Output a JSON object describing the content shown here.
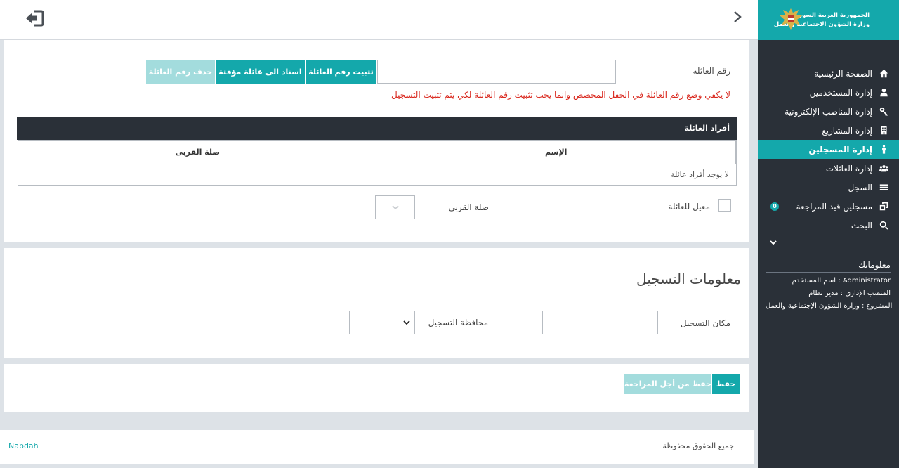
{
  "header": {
    "brand_line1": "الجمهورية العربية السورية",
    "brand_line2": "وزارة الشؤون الاجتماعية والعمل"
  },
  "sidebar": {
    "items": [
      {
        "label": "الصفحة الرئيسية",
        "icon": "home-icon"
      },
      {
        "label": "إدارة المستخدمين",
        "icon": "user-icon"
      },
      {
        "label": "إدارة المناصب الإلكترونية",
        "icon": "key-icon"
      },
      {
        "label": "إدارة المشاريع",
        "icon": "building-icon"
      },
      {
        "label": "إدارة المسجلين",
        "icon": "person-icon",
        "active": true
      },
      {
        "label": "إدارة العائلات",
        "icon": "users-icon"
      },
      {
        "label": "السجل",
        "icon": "list-icon"
      },
      {
        "label": "مسجلين قيد المراجعة",
        "icon": "review-icon",
        "badge": "0"
      },
      {
        "label": "البحث",
        "icon": "search-icon"
      }
    ],
    "info_title": "معلوماتك",
    "info_username": "اسم المستخدم : Administrator",
    "info_position": "المنصب الإداري : مدير نظام",
    "info_project": "المشروع : وزارة الشؤون الإجتماعية والعمل"
  },
  "family": {
    "number_label": "رقم العائلة",
    "number_value": "",
    "btn_confirm": "تثبيت رقم العائلة",
    "btn_assign_temp": "اسناد الى عائلة مؤقتة",
    "btn_delete": "حذف رقم العائلة",
    "warning": "لا يكفي وضع رقم العائلة في الحقل المخصص وانما يجب تثبيت رقم العائلة لكي يتم تثبيت التسجيل",
    "members_title": "أفراد العائلة",
    "col_name": "الإسم",
    "col_relation": "صلة القربى",
    "empty": "لا يوجد أفراد عائلة",
    "provider_label": "معيل للعائلة",
    "relation_label": "صلة القربى",
    "relation_value": ""
  },
  "registration": {
    "title": "معلومات التسجيل",
    "place_label": "مكان التسجيل",
    "place_value": "",
    "province_label": "محافظة التسجيل",
    "province_value": ""
  },
  "actions": {
    "save": "حفظ",
    "save_review": "حفظ من أجل المراجعة"
  },
  "footer": {
    "credit": "Nabdah",
    "rights": "جميع الحقوق محفوظة"
  },
  "colors": {
    "accent": "#14a8ab",
    "sidebar": "#2a3038",
    "warning": "#d9261c"
  }
}
